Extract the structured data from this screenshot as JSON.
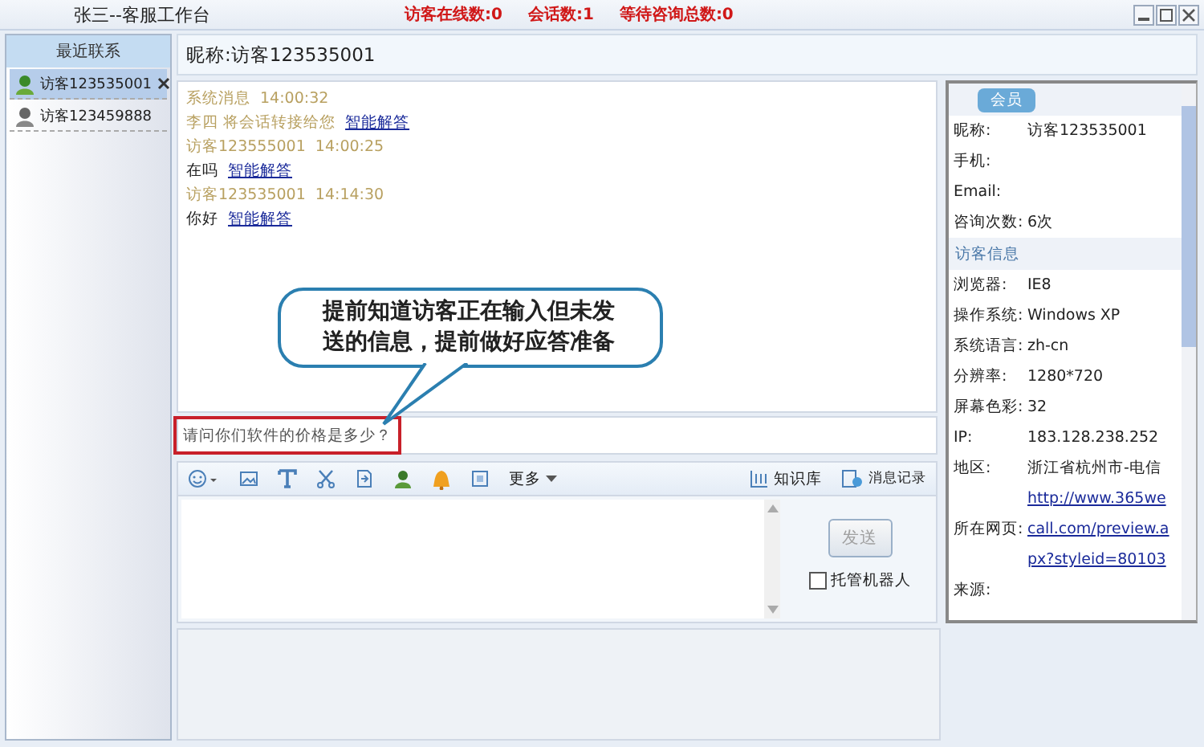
{
  "window": {
    "title": "张三--客服工作台",
    "stats": [
      "访客在线数:0",
      "会话数:1",
      "等待咨询总数:0"
    ]
  },
  "sidebar": {
    "title": "最近联系",
    "items": [
      {
        "label": "访客123535001",
        "selected": true,
        "online": true
      },
      {
        "label": "访客123459888",
        "selected": false,
        "online": false
      }
    ]
  },
  "chat": {
    "header": "昵称:访客123535001",
    "messages": [
      {
        "kind": "meta",
        "text": "系统消息",
        "time": "14:00:32"
      },
      {
        "kind": "notice",
        "text": "李四 将会话转接给您",
        "link": "智能解答"
      },
      {
        "kind": "meta",
        "text": "访客123555001",
        "time": "14:00:25"
      },
      {
        "kind": "text",
        "text": "在吗",
        "link": "智能解答"
      },
      {
        "kind": "meta",
        "text": "访客123535001",
        "time": "14:14:30"
      },
      {
        "kind": "text",
        "text": "你好",
        "link": "智能解答"
      }
    ],
    "callout": "提前知道访客正在输入但未发送的信息，提前做好应答准备",
    "typing_preview": "请问你们软件的价格是多少？"
  },
  "toolbar": {
    "more": "更多",
    "knowledge": "知识库",
    "history": "消息记录"
  },
  "composer": {
    "send": "发送",
    "send_disabled": true,
    "robot": {
      "label": "托管机器人",
      "checked": false
    }
  },
  "info": {
    "tab": "会员",
    "member": [
      {
        "label": "昵称:",
        "value": "访客123535001"
      },
      {
        "label": "手机:"
      },
      {
        "label": "Email:"
      },
      {
        "label": "咨询次数:",
        "value": "6次"
      }
    ],
    "visitor_title": "访客信息",
    "visitor": [
      {
        "label": "浏览器:",
        "value": "IE8"
      },
      {
        "label": "操作系统:",
        "value": "Windows XP"
      },
      {
        "label": "系统语言:",
        "value": "zh-cn"
      },
      {
        "label": "分辨率:",
        "value": "1280*720"
      },
      {
        "label": "屏幕色彩:",
        "value": "32"
      },
      {
        "label": "IP:",
        "value": "183.128.238.252"
      },
      {
        "label": "地区:",
        "value": "浙江省杭州市-电信"
      },
      {
        "kind": "link",
        "value": "http://www.365we"
      },
      {
        "kind": "link",
        "label": "所在网页:",
        "value": "call.com/preview.a"
      },
      {
        "kind": "link",
        "value": "px?styleid=80103"
      },
      {
        "label": "来源:"
      }
    ]
  }
}
